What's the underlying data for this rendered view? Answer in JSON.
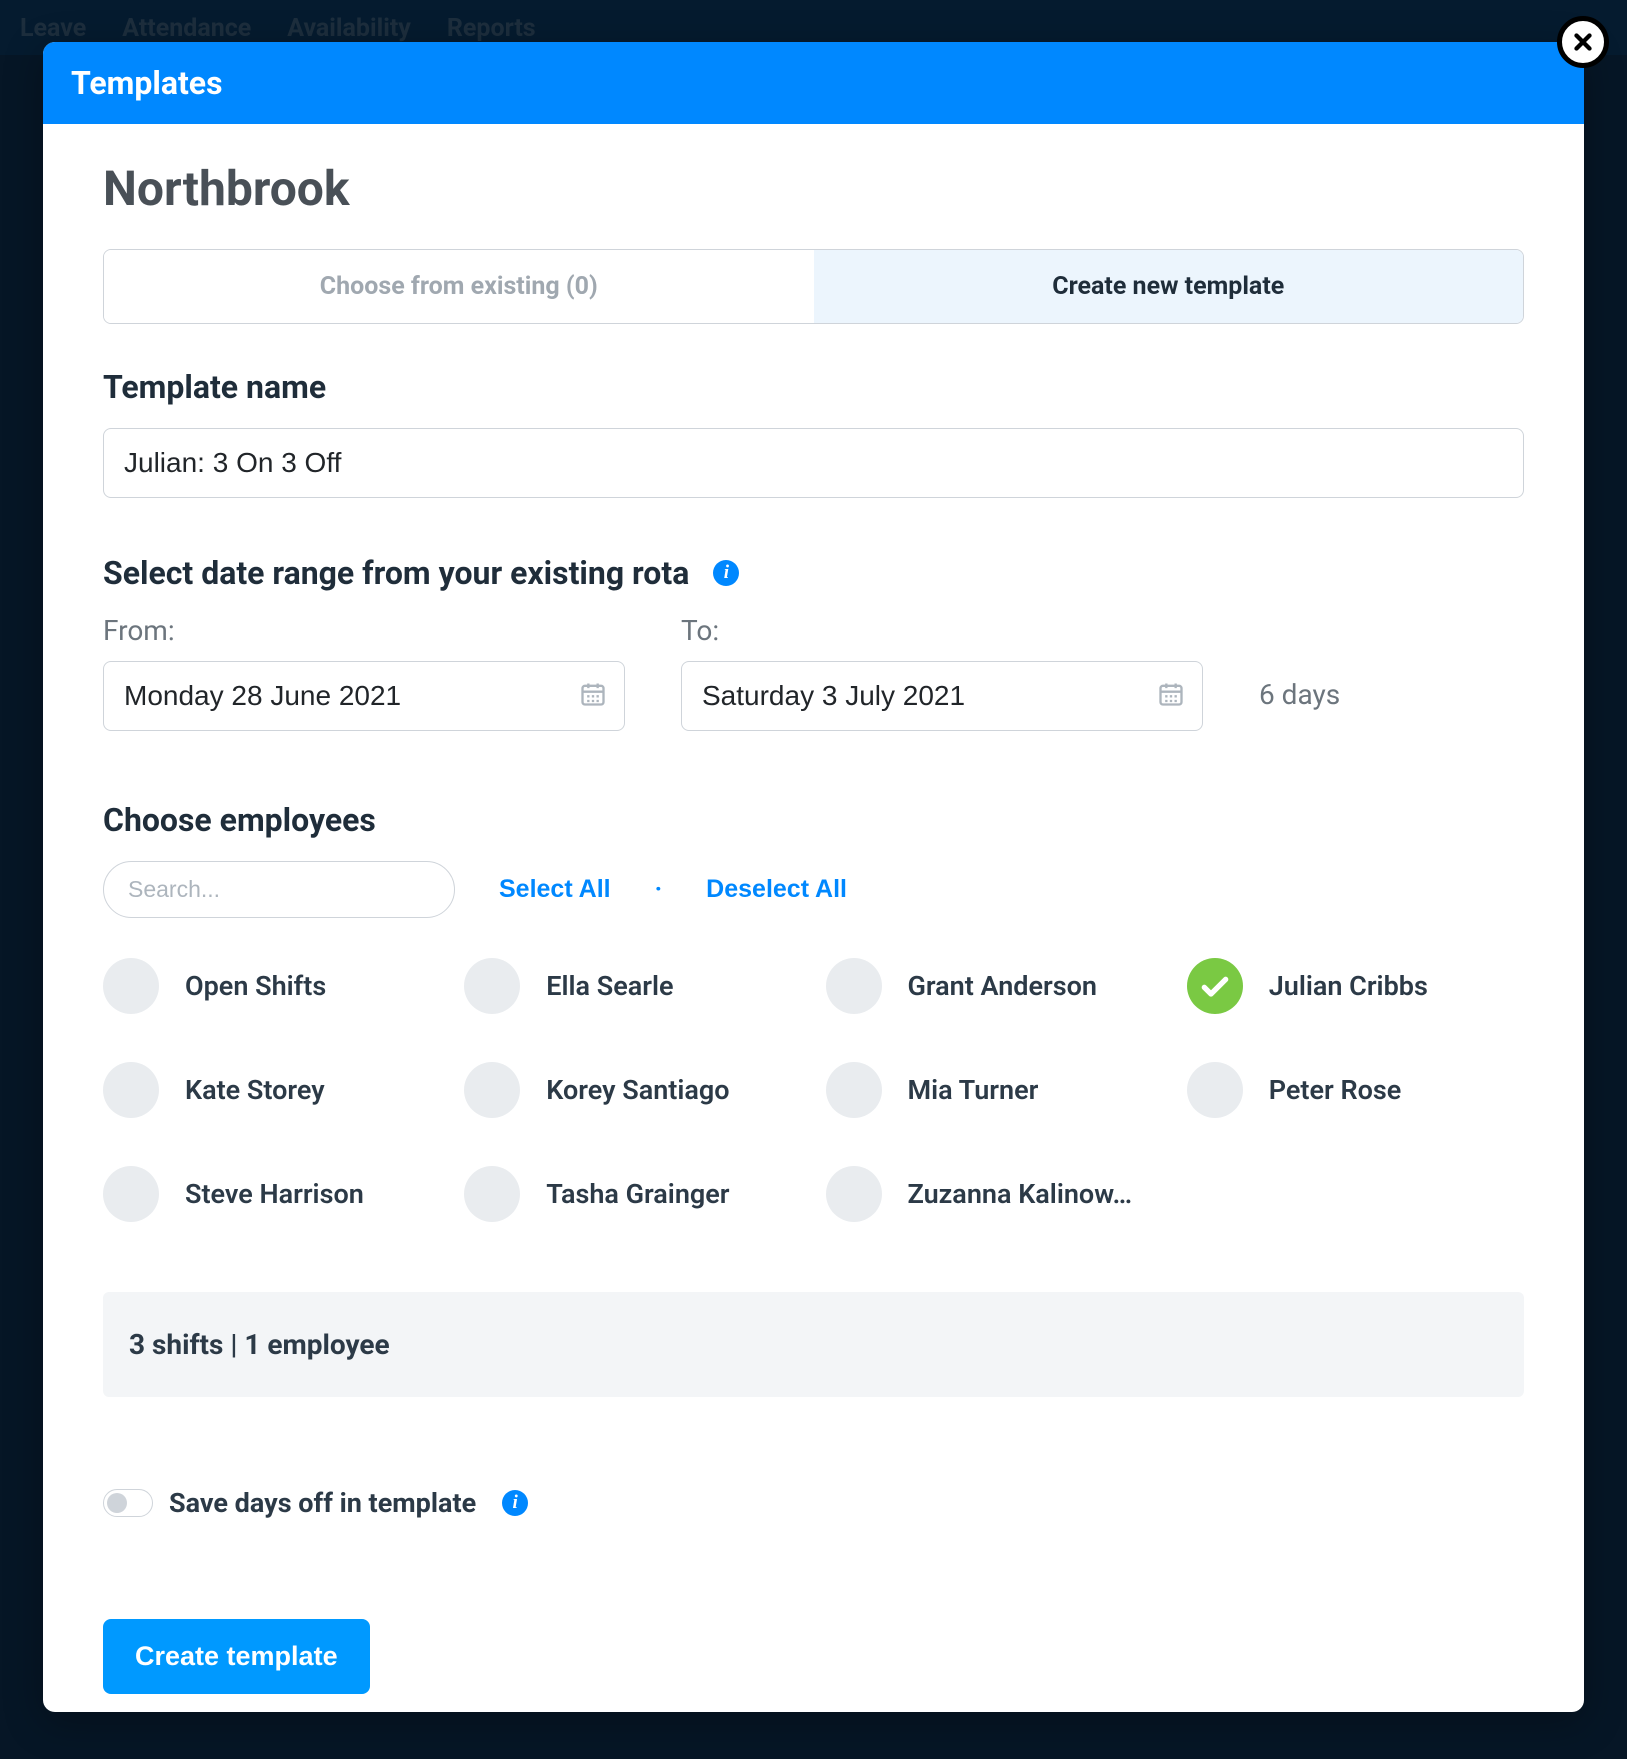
{
  "bgNav": [
    "Leave",
    "Attendance",
    "Availability",
    "Reports"
  ],
  "modal": {
    "title": "Templates",
    "pageHeading": "Northbrook",
    "tabs": {
      "existing": "Choose from existing (0)",
      "create": "Create new template"
    },
    "templateName": {
      "heading": "Template name",
      "value": "Julian: 3 On 3 Off"
    },
    "dateRange": {
      "heading": "Select date range from your existing rota",
      "fromLabel": "From:",
      "toLabel": "To:",
      "fromValue": "Monday 28 June 2021",
      "toValue": "Saturday 3 July 2021",
      "daysText": "6 days"
    },
    "employees": {
      "heading": "Choose employees",
      "searchPlaceholder": "Search...",
      "selectAll": "Select All",
      "deselectAll": "Deselect All",
      "list": [
        {
          "name": "Open Shifts",
          "checked": false
        },
        {
          "name": "Ella Searle",
          "checked": false
        },
        {
          "name": "Grant Anderson",
          "checked": false
        },
        {
          "name": "Julian Cribbs",
          "checked": true
        },
        {
          "name": "Kate Storey",
          "checked": false
        },
        {
          "name": "Korey Santiago",
          "checked": false
        },
        {
          "name": "Mia Turner",
          "checked": false
        },
        {
          "name": "Peter Rose",
          "checked": false
        },
        {
          "name": "Steve Harrison",
          "checked": false
        },
        {
          "name": "Tasha Grainger",
          "checked": false
        },
        {
          "name": "Zuzanna Kalinow…",
          "checked": false
        }
      ]
    },
    "summary": "3 shifts | 1 employee",
    "saveDaysOff": "Save days off in template",
    "createButton": "Create template"
  }
}
